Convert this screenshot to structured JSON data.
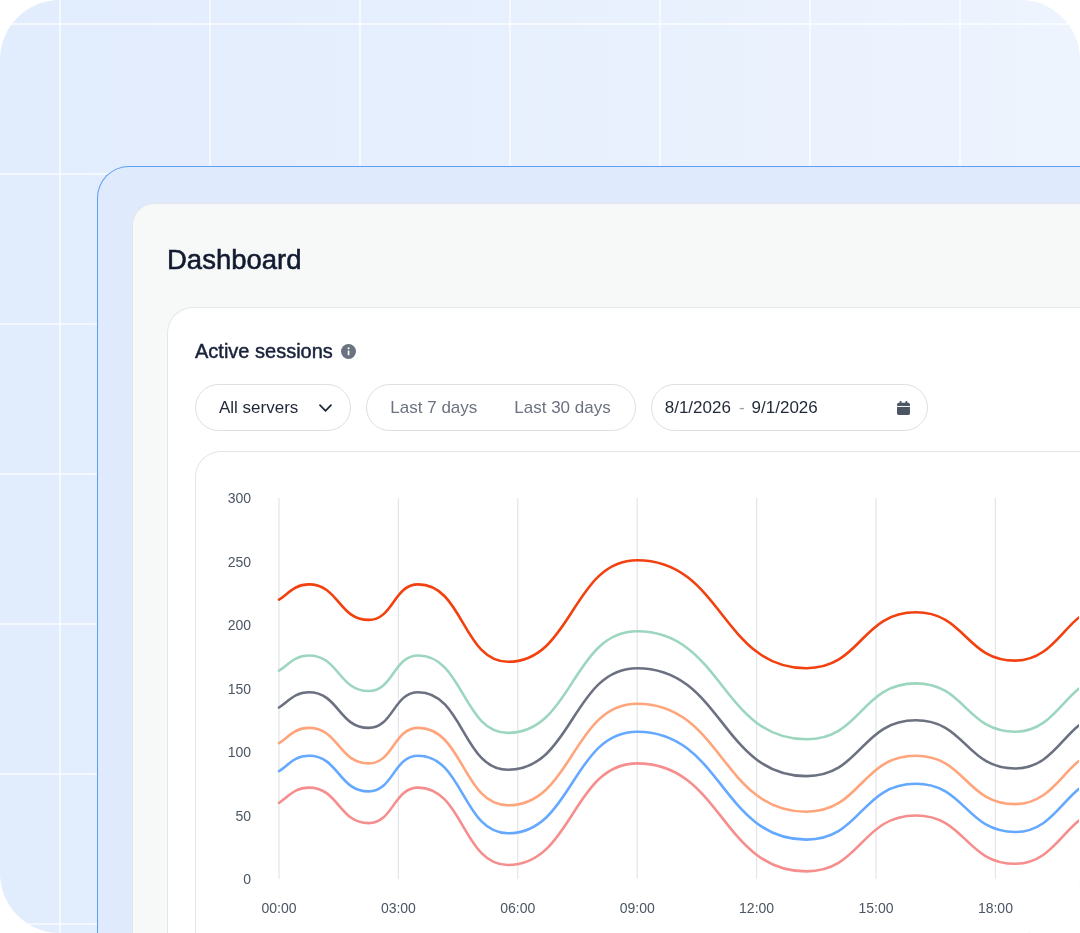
{
  "page": {
    "title": "Dashboard"
  },
  "card": {
    "title": "Active sessions",
    "server_select": {
      "value": "All servers"
    },
    "range_tabs": [
      {
        "label": "Last 7 days",
        "selected": false
      },
      {
        "label": "Last 30 days",
        "selected": false
      }
    ],
    "date_range": {
      "start": "8/1/2026",
      "separator": "-",
      "end": "9/1/2026"
    },
    "chart": {
      "chart_data": {
        "type": "line",
        "grid": true,
        "x": [
          0,
          0.75,
          2.25,
          3.5,
          5.75,
          9,
          13.25,
          16,
          18.5,
          20.1
        ],
        "xlim": [
          0,
          20.1
        ],
        "ylim": [
          0,
          300
        ],
        "xticks": [
          {
            "value": 0,
            "label": "00:00"
          },
          {
            "value": 3,
            "label": "03:00"
          },
          {
            "value": 6,
            "label": "06:00"
          },
          {
            "value": 9,
            "label": "09:00"
          },
          {
            "value": 12,
            "label": "12:00"
          },
          {
            "value": 15,
            "label": "15:00"
          },
          {
            "value": 18,
            "label": "18:00"
          }
        ],
        "yticks": [
          0,
          50,
          100,
          150,
          200,
          250,
          300
        ],
        "series": [
          {
            "color": "#f2410f",
            "values": [
              220,
              232,
              204,
              232,
              171,
              251,
              166,
              210,
              172,
              206
            ]
          },
          {
            "color": "#9dd6bf",
            "values": [
              164,
              176,
              148,
              176,
              115,
              195,
              110,
              154,
              116,
              150
            ]
          },
          {
            "color": "#6b7180",
            "values": [
              135,
              147,
              119,
              147,
              86,
              166,
              81,
              125,
              87,
              121
            ]
          },
          {
            "color": "#ffa57c",
            "values": [
              107,
              119,
              91,
              119,
              58,
              138,
              53,
              97,
              59,
              93
            ]
          },
          {
            "color": "#64a9ff",
            "values": [
              85,
              97,
              69,
              97,
              36,
              116,
              31,
              75,
              37,
              71
            ]
          },
          {
            "color": "#f58e8c",
            "values": [
              60,
              72,
              44,
              72,
              11,
              91,
              6,
              50,
              12,
              46
            ]
          }
        ]
      }
    }
  }
}
